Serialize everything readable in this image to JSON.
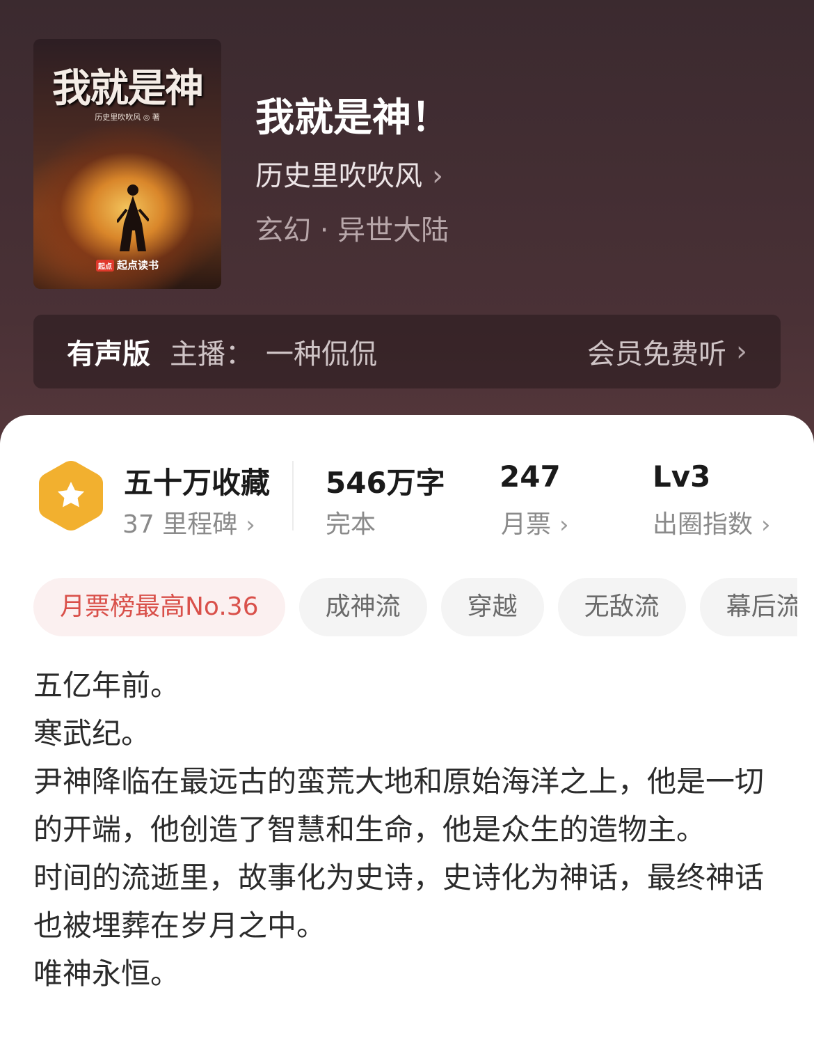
{
  "cover": {
    "title": "我就是神",
    "author_line": "历史里吹吹风 ◎ 著",
    "brand_logo": "起点",
    "brand": "起点读书"
  },
  "book": {
    "title": "我就是神！",
    "author": "历史里吹吹风",
    "category": "玄幻 · 异世大陆"
  },
  "audio": {
    "label": "有声版",
    "narrator_prefix": "主播：",
    "narrator": "一种侃侃",
    "cta": "会员免费听"
  },
  "stats": {
    "collect": {
      "main": "五十万收藏",
      "sub": "37 里程碑"
    },
    "words": {
      "main": "546万字",
      "sub": "完本"
    },
    "votes": {
      "main": "247",
      "sub": "月票"
    },
    "level": {
      "main": "Lv3",
      "sub": "出圈指数"
    }
  },
  "tags": [
    "月票榜最高No.36",
    "成神流",
    "穿越",
    "无敌流",
    "幕后流"
  ],
  "synopsis": [
    "五亿年前。",
    "寒武纪。",
    "尹神降临在最远古的蛮荒大地和原始海洋之上，他是一切的开端，他创造了智慧和生命，他是众生的造物主。",
    "时间的流逝里，故事化为史诗，史诗化为神话，最终神话也被埋葬在岁月之中。",
    "唯神永恒。"
  ],
  "icons": {
    "chevron": "chevron-right-icon",
    "badge": "star-hexagon-icon"
  },
  "colors": {
    "header_bg": "#4a3136",
    "rank_tag_text": "#d9504a",
    "badge": "#f2b02f"
  }
}
